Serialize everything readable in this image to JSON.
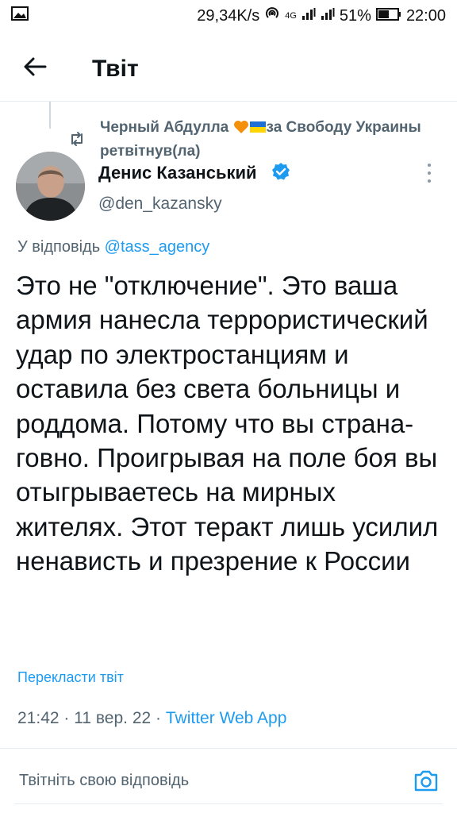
{
  "status_bar": {
    "speed": "29,34K/s",
    "network_label": "4G",
    "battery": "51%",
    "time": "22:00"
  },
  "header": {
    "title": "Твіт",
    "back_icon": "arrow-left-icon"
  },
  "retweet_context": {
    "retweeter": "Черный Абдулла",
    "suffix": "за Свободу Украины",
    "action": "ретвітнув(ла)"
  },
  "tweet": {
    "author_name": "Денис Казанський",
    "author_handle": "@den_kazansky",
    "reply_prefix": "У відповідь ",
    "reply_mention": "@tass_agency",
    "text": "Это не \"отключение\". Это ваша армия нанесла террористический удар по электростанциям и оставила без света больницы и роддома. Потому что вы страна-говно. Проигрывая на поле боя вы отыгрываетесь на мирных жителях. Этот теракт лишь усилил ненависть и презрение к России",
    "translate_label": "Перекласти твіт",
    "time": "21:42",
    "date": "11 вер. 22",
    "separator": "·",
    "source": "Twitter Web App"
  },
  "reply_bar": {
    "placeholder": "Твітніть свою відповідь"
  },
  "colors": {
    "accent": "#1d9bf0",
    "secondary_text": "#536471",
    "primary_text": "#0f1419"
  }
}
